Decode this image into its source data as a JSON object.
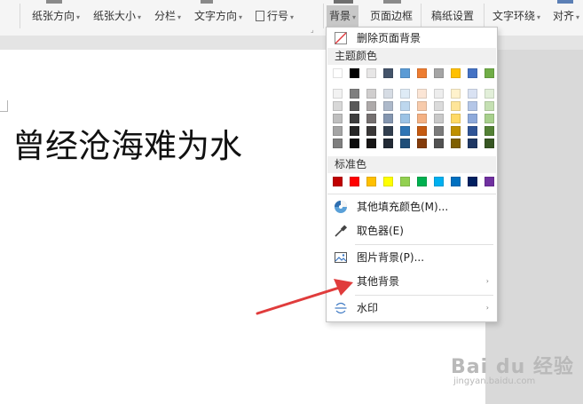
{
  "ribbon": {
    "items": [
      {
        "label": "纸张方向",
        "caret": "▾"
      },
      {
        "label": "纸张大小",
        "caret": "▾"
      },
      {
        "label": "分栏",
        "caret": "▾"
      },
      {
        "label": "文字方向",
        "caret": "▾"
      },
      {
        "label": "行号",
        "caret": "▾"
      },
      {
        "label": "背景",
        "caret": "▾"
      },
      {
        "label": "页面边框",
        "caret": ""
      },
      {
        "label": "稿纸设置",
        "caret": ""
      },
      {
        "label": "文字环绕",
        "caret": "▾"
      },
      {
        "label": "对齐",
        "caret": "▾"
      }
    ],
    "corner_mark": "⌟"
  },
  "document": {
    "text": "曾经沧海难为水"
  },
  "menu": {
    "remove_background": "删除页面背景",
    "theme_colors_title": "主题颜色",
    "standard_colors_title": "标准色",
    "more_fill_colors": "其他填充颜色(M)...",
    "eyedropper": "取色器(E)",
    "picture_background": "图片背景(P)...",
    "other_background": "其他背景",
    "watermark": "水印",
    "sub_arrow": "›",
    "theme_top": [
      "#ffffff",
      "#000000",
      "#e7e6e6",
      "#44546a",
      "#5b9bd5",
      "#ed7d31",
      "#a5a5a5",
      "#ffc000",
      "#4472c4",
      "#70ad47"
    ],
    "theme_shades": [
      [
        "#f2f2f2",
        "#7f7f7f",
        "#d0cece",
        "#d6dce4",
        "#deebf6",
        "#fbe5d5",
        "#ededed",
        "#fff2cc",
        "#d9e2f3",
        "#e2efd9"
      ],
      [
        "#d8d8d8",
        "#595959",
        "#aeaaaa",
        "#adb9ca",
        "#bdd7ee",
        "#f7cbac",
        "#dbdbdb",
        "#fee599",
        "#b4c6e7",
        "#c5e0b3"
      ],
      [
        "#bfbfbf",
        "#3f3f3f",
        "#757070",
        "#8496b0",
        "#9cc3e5",
        "#f4b183",
        "#c9c9c9",
        "#ffd965",
        "#8eaadb",
        "#a8d08d"
      ],
      [
        "#a5a5a5",
        "#262626",
        "#3a3838",
        "#323f4f",
        "#2e75b5",
        "#c55a11",
        "#7b7b7b",
        "#bf9000",
        "#2f5496",
        "#538135"
      ],
      [
        "#7f7f7f",
        "#0c0c0c",
        "#171616",
        "#222a35",
        "#1e4e79",
        "#843c0b",
        "#525252",
        "#7f6000",
        "#1f3864",
        "#375623"
      ]
    ],
    "standard": [
      "#c00000",
      "#ff0000",
      "#ffc000",
      "#ffff00",
      "#92d050",
      "#00b050",
      "#00b0f0",
      "#0070c0",
      "#002060",
      "#7030a0"
    ]
  },
  "watermark_brand": {
    "main": "Bai du 经验",
    "sub": "jingyan.baidu.com"
  },
  "colors": {
    "arrow": "#e03c3c"
  }
}
